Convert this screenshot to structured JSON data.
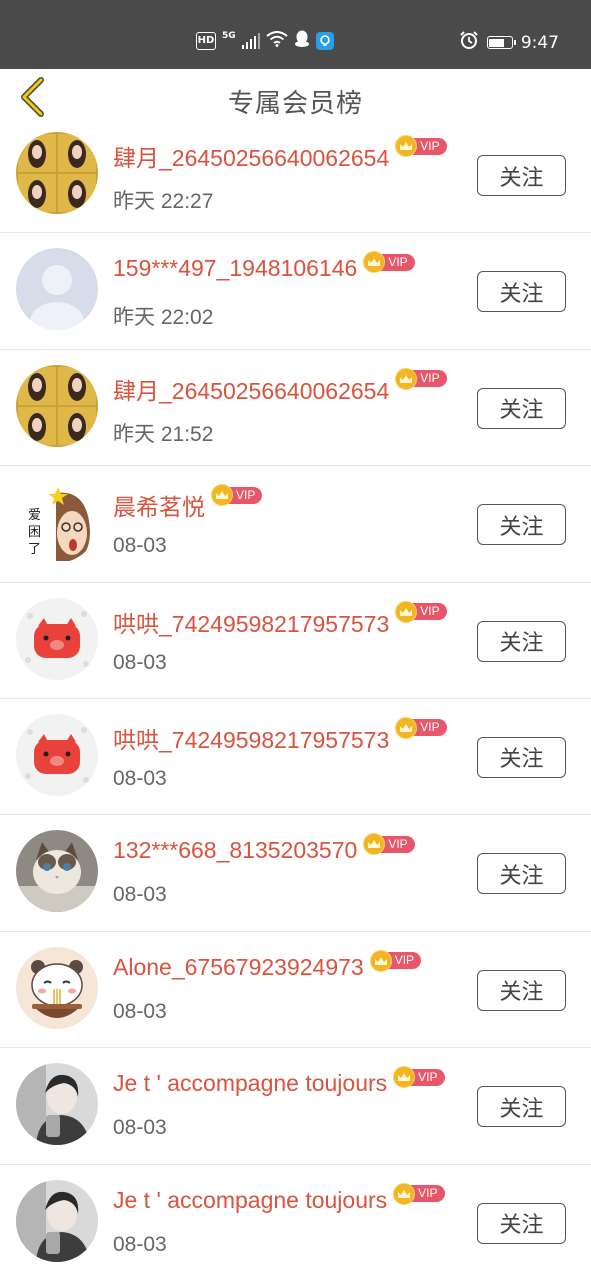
{
  "status_bar": {
    "hd_label": "HD",
    "network_label": "5G",
    "time": "9:47",
    "icons": [
      "signal-icon",
      "wifi-icon",
      "qq-icon",
      "app-notification-icon",
      "alarm-icon",
      "battery-icon"
    ]
  },
  "nav": {
    "title": "专属会员榜",
    "back_icon": "chevron-left-icon"
  },
  "colors": {
    "accent": "#f5c518",
    "name_color": "#d9533f",
    "vip_tag": "#e8566a",
    "crown": "#f3b623"
  },
  "vip_label": "VIP",
  "follow_label": "关注",
  "members": [
    {
      "name": "肆月_26450256640062654",
      "time": "昨天 22:27",
      "avatar": "photo-grid-avatar"
    },
    {
      "name": "159***497_1948106146",
      "time": "昨天 22:02",
      "avatar": "default-avatar"
    },
    {
      "name": "肆月_26450256640062654",
      "time": "昨天 21:52",
      "avatar": "photo-grid-avatar"
    },
    {
      "name": "晨希茗悦",
      "time": "08-03",
      "avatar": "cartoon-girl-avatar"
    },
    {
      "name": "哄哄_74249598217957573",
      "time": "08-03",
      "avatar": "red-pig-avatar"
    },
    {
      "name": "哄哄_74249598217957573",
      "time": "08-03",
      "avatar": "red-pig-avatar"
    },
    {
      "name": "132***668_8135203570",
      "time": "08-03",
      "avatar": "cat-avatar"
    },
    {
      "name": "Alone_67567923924973",
      "time": "08-03",
      "avatar": "panda-noodles-avatar"
    },
    {
      "name": "Je t ' accompagne toujours",
      "time": "08-03",
      "avatar": "bw-photo-avatar"
    },
    {
      "name": "Je t ' accompagne toujours",
      "time": "08-03",
      "avatar": "bw-photo-avatar"
    }
  ]
}
